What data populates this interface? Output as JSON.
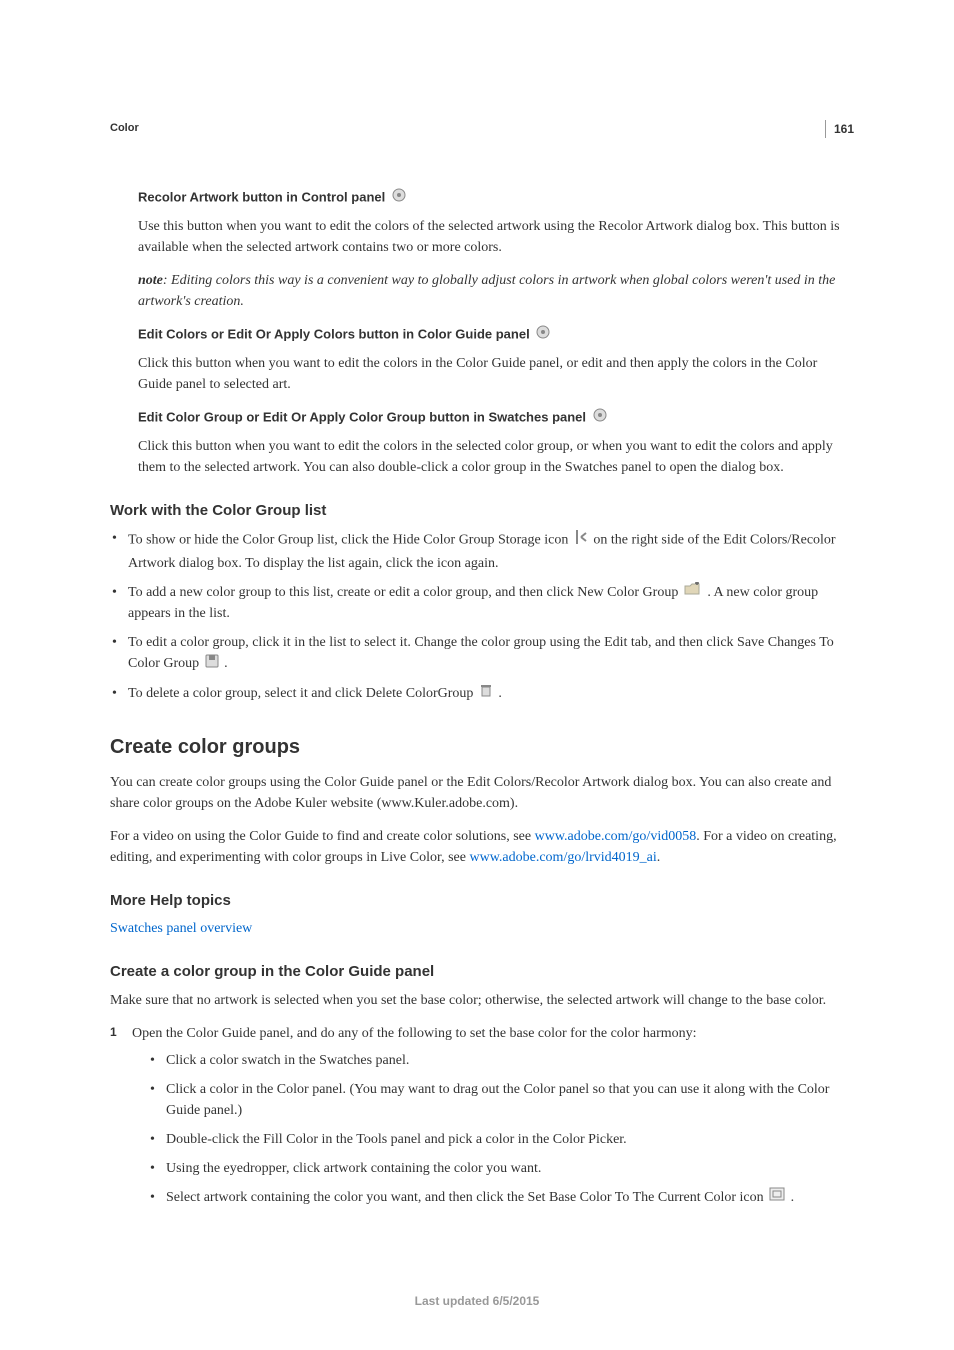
{
  "pageNumber": "161",
  "breadcrumb": "Color",
  "defs": [
    {
      "term": "Recolor Artwork button in Control panel",
      "body": "Use this button when you want to edit the colors of the selected artwork using the Recolor Artwork dialog box. This button is available when the selected artwork contains two or more colors.",
      "note": ": Editing colors this way is a convenient way to globally adjust colors in artwork when global colors weren't used in the artwork's creation."
    },
    {
      "term": "Edit Colors or Edit Or Apply Colors button in Color Guide panel",
      "body": "Click this button when you want to edit the colors in the Color Guide panel, or edit and then apply the colors in the Color Guide panel to selected art."
    },
    {
      "term": "Edit Color Group or Edit Or Apply Color Group button in Swatches panel",
      "body": "Click this button when you want to edit the colors in the selected color group, or when you want to edit the colors and apply them to the selected artwork. You can also double-click a color group in the Swatches panel to open the dialog box."
    }
  ],
  "subhead1": "Work with the Color Group list",
  "workList": [
    {
      "pre": "To show or hide the Color Group list, click the Hide Color Group Storage icon ",
      "post": " on the right side of the Edit Colors/Recolor Artwork dialog box. To display the list again, click the icon again."
    },
    {
      "pre": "To add a new color group to this list, create or edit a color group, and then click New Color Group ",
      "post": ". A new color group appears in the list."
    },
    {
      "pre": "To edit a color group, click it in the list to select it. Change the color group using the Edit tab, and then click Save Changes To Color Group ",
      "post": "."
    },
    {
      "pre": "To delete a color group, select it and click Delete ColorGroup ",
      "post": "."
    }
  ],
  "sectionHead": "Create color groups",
  "sectionBody1": "You can create color groups using the Color Guide panel or the Edit Colors/Recolor Artwork dialog box. You can also create and share color groups on the Adobe Kuler website (www.Kuler.adobe.com).",
  "sectionBody2a": "For a video on using the Color Guide to find and create color solutions, see ",
  "link1": "www.adobe.com/go/vid0058",
  "sectionBody2b": ". For a video on creating, editing, and experimenting with color groups in Live Color, see ",
  "link2": "www.adobe.com/go/lrvid4019_ai",
  "sectionBody2c": ".",
  "moreHelpHead": "More Help topics",
  "moreHelpLink": "Swatches panel overview",
  "subhead2": "Create a color group in the Color Guide panel",
  "createIntro": "Make sure that no artwork is selected when you set the base color; otherwise, the selected artwork will change to the base color.",
  "step1Intro": "Open the Color Guide panel, and do any of the following to set the base color for the color harmony:",
  "step1Subs": [
    "Click a color swatch in the Swatches panel.",
    "Click a color in the Color panel. (You may want to drag out the Color panel so that you can use it along with the Color Guide panel.)",
    "Double-click the Fill Color in the Tools panel and pick a color in the Color Picker.",
    "Using the eyedropper, click artwork containing the color you want."
  ],
  "step1LastPre": "Select artwork containing the color you want, and then click the Set Base Color To The Current Color icon ",
  "step1LastPost": ".",
  "noteLabel": "note",
  "footer": "Last updated 6/5/2015"
}
